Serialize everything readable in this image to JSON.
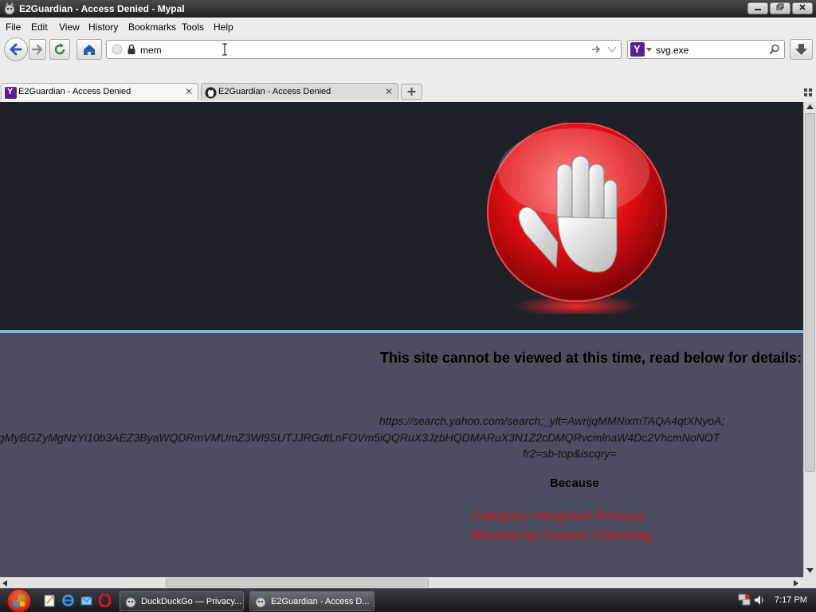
{
  "window": {
    "title": "E2Guardian - Access Denied - Mypal"
  },
  "menu": [
    "File",
    "Edit",
    "View",
    "History",
    "Bookmarks",
    "Tools",
    "Help"
  ],
  "urlbar": {
    "value": "mem"
  },
  "searchbar": {
    "value": "svg.exe"
  },
  "tabs": [
    {
      "label": "E2Guardian - Access Denied",
      "active": true
    },
    {
      "label": "E2Guardian - Access Denied",
      "active": false
    }
  ],
  "page": {
    "headline": "This site cannot be viewed at this time, read below for details:",
    "url_lines": [
      "https://search.yahoo.com/search;_ylt=AwrijqMMNixmTAQA4qtXNyoA;",
      "gMyBGZyMgNzYi10b3AEZ3ByaWQDRmVMUmZ3Wl9SUTJJRGdtLnFOVm5iQQRuX3JzbHQDMARuX3N1Z2cDMQRvcmlnaW4Dc2VhcmNoNOT",
      "fr2=sb-top&iscqry="
    ],
    "because": "Because",
    "reasons": [
      "Category: Weighted Phrases",
      "Blocked by Content Checking."
    ]
  },
  "taskbar": {
    "items": [
      {
        "label": "DuckDuckGo — Privacy..."
      },
      {
        "label": "E2Guardian - Access D..."
      }
    ],
    "clock": "7:17 PM"
  },
  "icons": [
    "e2guardian-app-icon",
    "back-arrow-icon",
    "forward-arrow-icon",
    "reload-icon",
    "home-icon",
    "lock-icon",
    "yahoo-icon",
    "github-icon",
    "stop-hand-icon",
    "windows-start-icon",
    "download-icon"
  ],
  "colors": {
    "accent_divider": "#7fb5e6",
    "reason_text": "#d5121b",
    "hero_bg": "#1f2129",
    "body_bg": "#4a4e5e"
  }
}
